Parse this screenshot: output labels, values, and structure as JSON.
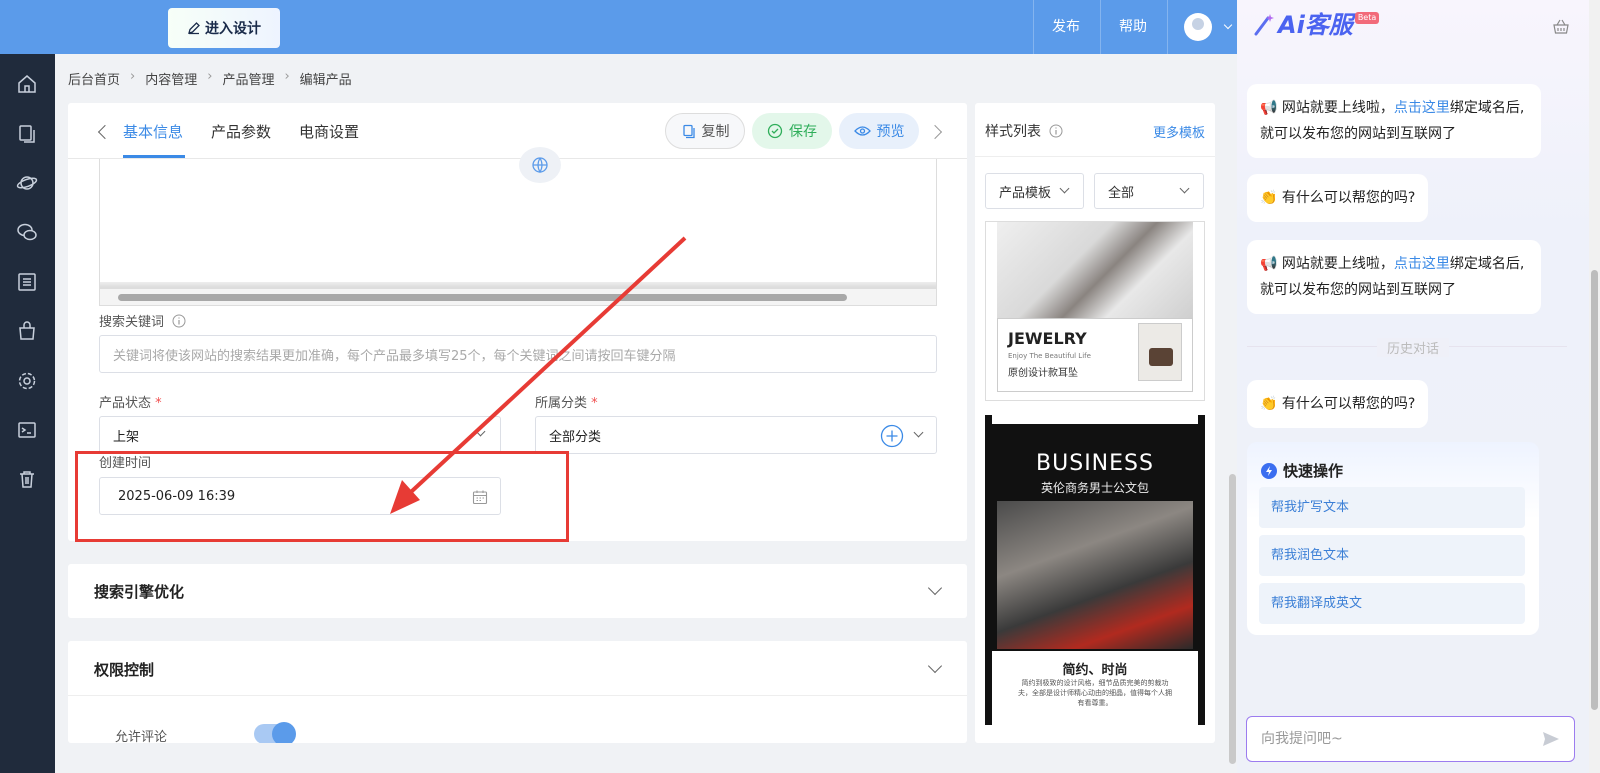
{
  "topbar": {
    "design_button": "进入设计",
    "publish": "发布",
    "help": "帮助"
  },
  "sidebar": {
    "icons": [
      "home-icon",
      "copy-icon",
      "planet-icon",
      "chat-icon",
      "list-icon",
      "bag-icon",
      "settings-icon",
      "terminal-icon",
      "trash-icon"
    ]
  },
  "breadcrumb": {
    "items": [
      "后台首页",
      "内容管理",
      "产品管理",
      "编辑产品"
    ]
  },
  "tabs": {
    "items": [
      "基本信息",
      "产品参数",
      "电商设置"
    ],
    "active": "基本信息"
  },
  "actions": {
    "copy": "复制",
    "save": "保存",
    "preview": "预览"
  },
  "form": {
    "keywords_label": "搜索关键词",
    "keywords_placeholder": "关键词将使该网站的搜索结果更加准确，每个产品最多填写25个，每个关键词之间请按回车键分隔",
    "status_label": "产品状态",
    "status_value": "上架",
    "category_label": "所属分类",
    "category_value": "全部分类",
    "created_label": "创建时间",
    "created_value": "2025-06-09 16:39",
    "required_mark": "*"
  },
  "sections": {
    "seo": "搜索引擎优化",
    "permissions": "权限控制",
    "allow_comments": "允许评论",
    "allow_comments_on": true
  },
  "style_panel": {
    "title": "样式列表",
    "more": "更多模板",
    "filter_type": "产品模板",
    "filter_all": "全部",
    "card1": {
      "title": "JEWELRY",
      "subtitle": "Enjoy The Beautiful Life",
      "caption": "原创设计款耳坠"
    },
    "card2": {
      "title": "BUSINESS",
      "subtitle": "英伦商务男士公文包",
      "heading": "简约、时尚",
      "text": "简约到极致的设计风格，细节品质完美的剪裁功夫，全部是设计师精心动由的细晶，值得每个人拥有看尊重。"
    }
  },
  "ai_chat": {
    "logo": "Ai客服",
    "badge": "Beta",
    "msg_launch_prefix": "网站就要上线啦，",
    "msg_launch_link": "点击这里",
    "msg_launch_suffix": "绑定域名后,就可以发布您的网站到互联网了",
    "msg_help": "有什么可以帮您的吗?",
    "history": "历史对话",
    "quick_title": "快速操作",
    "quick_actions": [
      "帮我扩写文本",
      "帮我润色文本",
      "帮我翻译成英文"
    ],
    "input_placeholder": "向我提问吧~"
  },
  "colors": {
    "topbar": "#5b9bea",
    "sidebar": "#202b3c",
    "accent": "#3b8ae6",
    "annotation": "#e73b35",
    "save_bg": "#e3f7ea",
    "save_fg": "#2fae5a"
  }
}
